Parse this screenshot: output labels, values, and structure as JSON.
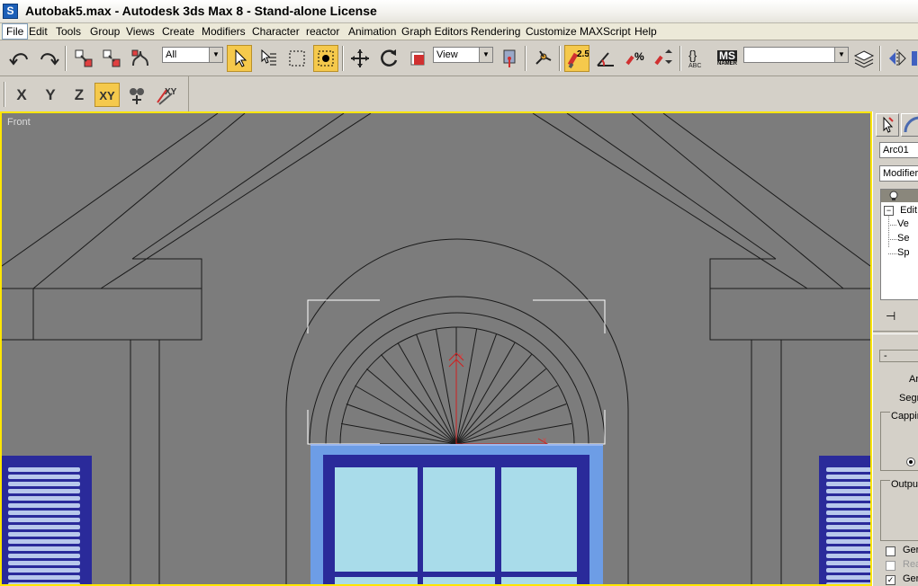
{
  "window": {
    "title": "Autobak5.max - Autodesk 3ds Max 8  - Stand-alone License",
    "icon": "3ds-max-app-icon"
  },
  "menu": [
    {
      "label": "File",
      "active": true
    },
    {
      "label": "Edit"
    },
    {
      "label": "Tools"
    },
    {
      "label": "Group"
    },
    {
      "label": "Views"
    },
    {
      "label": "Create"
    },
    {
      "label": "Modifiers"
    },
    {
      "label": "Character"
    },
    {
      "label": "reactor"
    },
    {
      "label": "Animation"
    },
    {
      "label": "Graph Editors"
    },
    {
      "label": "Rendering"
    },
    {
      "label": "Customize"
    },
    {
      "label": "MAXScript"
    },
    {
      "label": "Help"
    }
  ],
  "toolbar": {
    "selection_filter": "All",
    "reference_coord": "View",
    "snap_angle_label": "2.5",
    "named_selection_label": "MS",
    "named_selection_sub": "NAMER",
    "named_selection_value": "",
    "abc_label": "ABC"
  },
  "axis_constraints": {
    "x": "X",
    "y": "Y",
    "z": "Z",
    "xy": "XY",
    "xy_alt": "XY"
  },
  "viewport": {
    "label": "Front",
    "background": "#7c7c7c",
    "active_border": "#ffe600",
    "gizmo_x_label": "x",
    "gizmo_y_label": "y"
  },
  "command_panel": {
    "object_name": "Arc01",
    "modifier_list": "Modifier",
    "stack": {
      "root": "Edit",
      "children": [
        "Ve",
        "Se",
        "Sp"
      ]
    },
    "rollout_minus": "-",
    "params": {
      "ar": "Ar",
      "segs": "Segr",
      "capping": "Cappin",
      "output": "Outpu",
      "gen1": "Ger",
      "rea": "Rea",
      "gen2": "Ger"
    }
  }
}
